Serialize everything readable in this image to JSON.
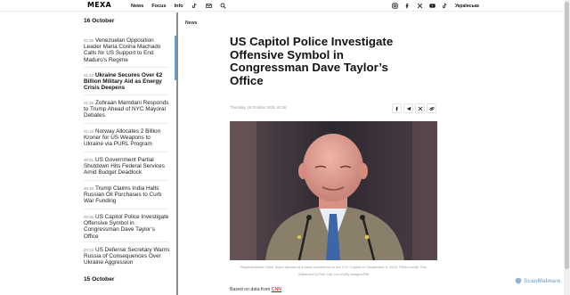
{
  "brand": {
    "logo": "MEXA"
  },
  "nav": {
    "items": [
      "News",
      "Focus",
      "Info"
    ]
  },
  "social": {
    "lang": "Українська"
  },
  "sidebar": {
    "date1": "16 October",
    "items": [
      {
        "time": "01:36",
        "text": "Venezuelan Opposition Leader Maria Corina Machado Calls for US Support to End Maduro’s Regime",
        "bold": false
      },
      {
        "time": "01:32",
        "text": "Ukraine Secures Over €2 Billion Military Aid as Energy Crisis Deepens",
        "bold": true
      },
      {
        "time": "01:25",
        "text": "Zohraan Mamdani Responds to Trump Ahead of NYC Mayoral Debates",
        "bold": false
      },
      {
        "time": "01:18",
        "text": "Norway Allocates 2 Billion Kroner for US Weapons to Ukraine via PURL Program",
        "bold": false
      },
      {
        "time": "00:51",
        "text": "US Government Partial Shutdown Hits Federal Services Amid Budget Deadlock",
        "bold": false
      },
      {
        "time": "00:48",
        "text": "Trump Claims India Halts Russian Oil Purchases to Curb War Funding",
        "bold": false
      },
      {
        "time": "00:36",
        "text": "US Capitol Police Investigate Offensive Symbol in Congressman Dave Taylor’s Office",
        "bold": false
      },
      {
        "time": "00:33",
        "text": "US Defense Secretary Warns Russia of Consequences Over Ukraine Aggression",
        "bold": false
      }
    ],
    "date2": "15 October"
  },
  "article": {
    "section": "News",
    "title": "US Capitol Police Investigate Offensive Symbol in Congressman Dave Taylor’s Office",
    "meta": "Thursday, 16 October 2025, 00:36",
    "caption": "Representative Dave Taylor speaks at a news conference in the U.S. Capitol on September 3, 2025. Photo credit: Tom Williams/CQ-Roll Call, Inc./Getty Images/File",
    "source_prefix": "Based on data from",
    "source_link": "CNN"
  },
  "watermark": "ScanMalware",
  "icons": {
    "nav": [
      "tiktok-icon",
      "mail-icon",
      "search-icon"
    ],
    "social": [
      "instagram-icon",
      "facebook-icon",
      "x-icon",
      "youtube-icon",
      "tiktok-icon"
    ],
    "share": [
      "facebook-icon",
      "telegram-icon",
      "x-icon",
      "link-icon"
    ]
  }
}
